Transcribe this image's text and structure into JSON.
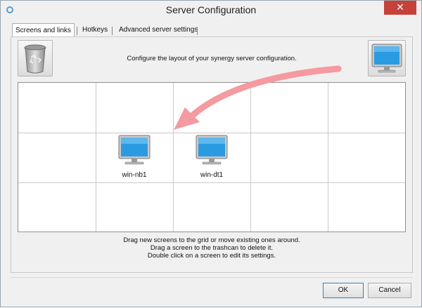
{
  "window": {
    "title": "Server Configuration",
    "close_label": "✕"
  },
  "tabs": [
    {
      "label": "Screens and links",
      "active": true
    },
    {
      "label": "Hotkeys",
      "active": false
    },
    {
      "label": "Advanced server settings",
      "active": false
    }
  ],
  "panel": {
    "instruction": "Configure the layout of your synergy server configuration.",
    "trashcan_icon": "trash-icon",
    "new_screen_icon": "monitor-icon"
  },
  "grid": {
    "columns": 5,
    "rows": 3,
    "screens": [
      {
        "name": "win-nb1",
        "col": 1,
        "row": 1
      },
      {
        "name": "win-dt1",
        "col": 2,
        "row": 1
      }
    ]
  },
  "help_lines": [
    "Drag new screens to the grid or move existing ones around.",
    "Drag a screen to the trashcan to delete it.",
    "Double click on a screen to edit its settings."
  ],
  "buttons": {
    "ok": "OK",
    "cancel": "Cancel"
  },
  "colors": {
    "arrow": "#f49aa0",
    "monitor_screen": "#2a9be0",
    "close_button": "#c7413b"
  }
}
